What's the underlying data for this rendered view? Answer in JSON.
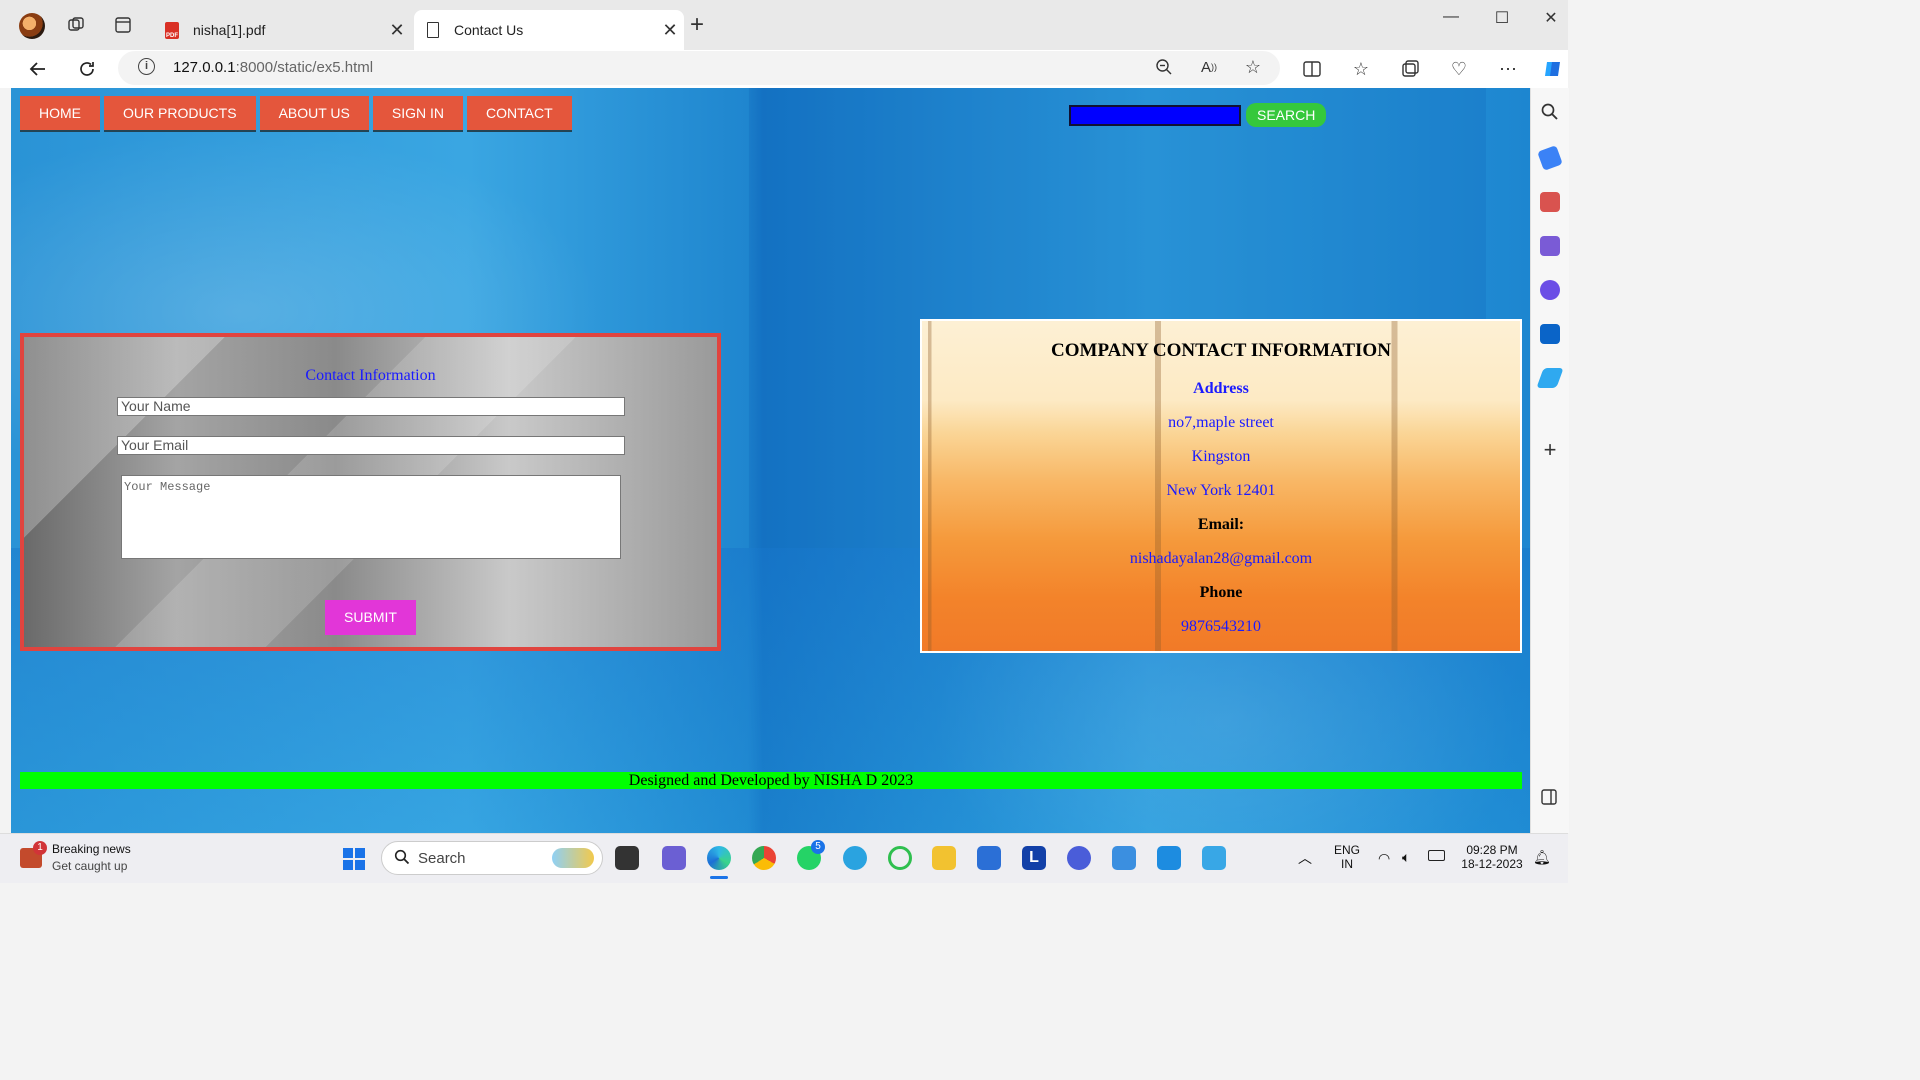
{
  "browser": {
    "tabs": [
      {
        "title": "nisha[1].pdf",
        "active": false
      },
      {
        "title": "Contact Us",
        "active": true
      }
    ],
    "url_host": "127.0.0.1",
    "url_path": ":8000/static/ex5.html"
  },
  "site": {
    "nav": [
      "HOME",
      "OUR PRODUCTS",
      "ABOUT US",
      "SIGN IN",
      "CONTACT"
    ],
    "search_button": "SEARCH",
    "form": {
      "title": "Contact Information",
      "name_placeholder": "Your Name",
      "email_placeholder": "Your Email",
      "message_placeholder": "Your Message",
      "submit": "SUBMIT"
    },
    "company": {
      "title": "COMPANY CONTACT INFORMATION",
      "address_label": "Address",
      "address_line1": "no7,maple street",
      "address_line2": "Kingston",
      "address_line3": "New York 12401",
      "email_label": "Email:",
      "email": "nishadayalan28@gmail.com",
      "phone_label": "Phone",
      "phone": "9876543210"
    },
    "footer": "Designed and Developed by NISHA D 2023"
  },
  "taskbar": {
    "news_title": "Breaking news",
    "news_sub": "Get caught up",
    "news_badge": "1",
    "search_text": "Search",
    "whatsapp_badge": "5",
    "lang_line1": "ENG",
    "lang_line2": "IN",
    "time": "09:28 PM",
    "date": "18-12-2023"
  },
  "colors": {
    "nav_bg": "#e4563c",
    "search_box": "#0000ff",
    "search_btn": "#35c83c",
    "submit_bg": "#e236d8",
    "footer_bg": "#00ff00",
    "form_border": "#e0443f"
  }
}
